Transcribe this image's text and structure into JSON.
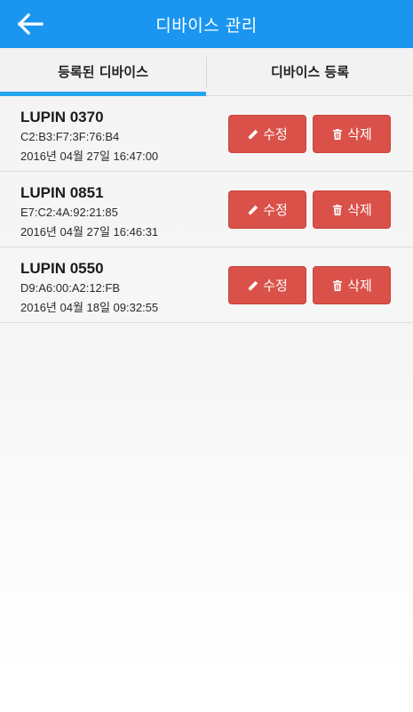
{
  "header": {
    "title": "디바이스 관리",
    "back_icon": "arrow-left-icon",
    "color": "#1a96f1"
  },
  "tabs": [
    {
      "label": "등록된 디바이스",
      "active": true
    },
    {
      "label": "디바이스 등록",
      "active": false
    }
  ],
  "actions": {
    "edit_label": "수정",
    "edit_icon": "pencil-icon",
    "delete_label": "삭제",
    "delete_icon": "trash-icon",
    "button_color": "#da5149"
  },
  "devices": [
    {
      "name": "LUPIN 0370",
      "mac": "C2:B3:F7:3F:76:B4",
      "date": "2016년 04월 27일 16:47:00"
    },
    {
      "name": "LUPIN 0851",
      "mac": "E7:C2:4A:92:21:85",
      "date": "2016년 04월 27일 16:46:31"
    },
    {
      "name": "LUPIN 0550",
      "mac": "D9:A6:00:A2:12:FB",
      "date": "2016년 04월 18일 09:32:55"
    }
  ]
}
